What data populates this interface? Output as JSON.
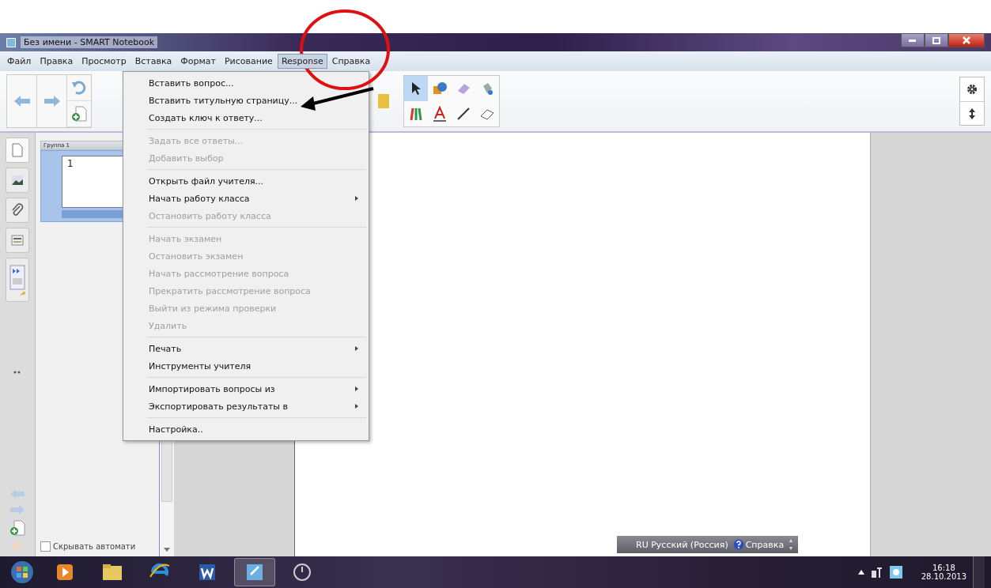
{
  "window": {
    "title": "Без имени - SMART Notebook"
  },
  "menu_bar": [
    {
      "label": "Файл",
      "selected": false
    },
    {
      "label": "Правка",
      "selected": false
    },
    {
      "label": "Просмотр",
      "selected": false
    },
    {
      "label": "Вставка",
      "selected": false
    },
    {
      "label": "Формат",
      "selected": false
    },
    {
      "label": "Рисование",
      "selected": false
    },
    {
      "label": "Response",
      "selected": true
    },
    {
      "label": "Справка",
      "selected": false
    }
  ],
  "page_sorter": {
    "group": "Группа 1",
    "page_number": "1",
    "hide_option": {
      "label": "Скрывать автомати",
      "checked": false
    }
  },
  "dropdown_menu": [
    {
      "kind": "item",
      "label": "Вставить вопрос...",
      "disabled": false,
      "submenu": false
    },
    {
      "kind": "item",
      "label": "Вставить титульную страницу...",
      "disabled": false,
      "submenu": false
    },
    {
      "kind": "item",
      "label": "Создать ключ к ответу...",
      "disabled": false,
      "submenu": false
    },
    {
      "kind": "separator"
    },
    {
      "kind": "item",
      "label": "Задать все ответы...",
      "disabled": true,
      "submenu": false
    },
    {
      "kind": "item",
      "label": "Добавить выбор",
      "disabled": true,
      "submenu": false
    },
    {
      "kind": "separator"
    },
    {
      "kind": "item",
      "label": "Открыть файл учителя...",
      "disabled": false,
      "submenu": false
    },
    {
      "kind": "item",
      "label": "Начать работу класса",
      "disabled": false,
      "submenu": true
    },
    {
      "kind": "item",
      "label": "Остановить работу класса",
      "disabled": true,
      "submenu": false
    },
    {
      "kind": "separator"
    },
    {
      "kind": "item",
      "label": "Начать экзамен",
      "disabled": true,
      "submenu": false
    },
    {
      "kind": "item",
      "label": "Остановить экзамен",
      "disabled": true,
      "submenu": false
    },
    {
      "kind": "item",
      "label": "Начать рассмотрение вопроса",
      "disabled": true,
      "submenu": false
    },
    {
      "kind": "item",
      "label": "Прекратить рассмотрение вопроса",
      "disabled": true,
      "submenu": false
    },
    {
      "kind": "item",
      "label": "Выйти из режима проверки",
      "disabled": true,
      "submenu": false
    },
    {
      "kind": "item",
      "label": "Удалить",
      "disabled": true,
      "submenu": false
    },
    {
      "kind": "separator"
    },
    {
      "kind": "item",
      "label": "Печать",
      "disabled": false,
      "submenu": true
    },
    {
      "kind": "item",
      "label": "Инструменты учителя",
      "disabled": false,
      "submenu": false
    },
    {
      "kind": "separator"
    },
    {
      "kind": "item",
      "label": "Импортировать вопросы из",
      "disabled": false,
      "submenu": true
    },
    {
      "kind": "item",
      "label": "Экспортировать результаты в",
      "disabled": false,
      "submenu": true
    },
    {
      "kind": "separator"
    },
    {
      "kind": "item",
      "label": "Настройка..",
      "disabled": false,
      "submenu": false
    }
  ],
  "language_bar": {
    "code": "RU",
    "language": "Русский (Россия)",
    "help": "Справка"
  },
  "taskbar": {
    "time": "16:18",
    "date": "28.10.2013"
  }
}
